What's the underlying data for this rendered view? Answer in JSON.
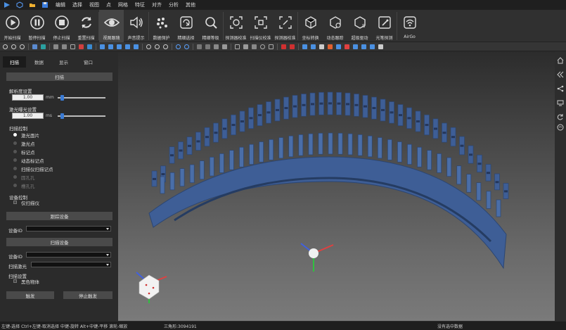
{
  "menubar": {
    "items": [
      "编辑",
      "选择",
      "视图",
      "点",
      "网格",
      "特征",
      "对齐",
      "分析",
      "其他"
    ]
  },
  "ribbon": {
    "buttons": [
      {
        "label": "开始扫描",
        "icon": "play-icon"
      },
      {
        "label": "暂停扫描",
        "icon": "pause-icon"
      },
      {
        "label": "停止扫描",
        "icon": "stop-icon"
      },
      {
        "label": "重置扫描",
        "icon": "reset-icon"
      },
      {
        "label": "视图跟随",
        "icon": "eye-icon"
      },
      {
        "label": "声音提示",
        "icon": "speaker-icon"
      },
      {
        "label": "数据保护",
        "icon": "data-protect-icon"
      },
      {
        "label": "精细选择",
        "icon": "refine-select-icon"
      },
      {
        "label": "精细等级",
        "icon": "refine-level-icon"
      },
      {
        "label": "探测器校准",
        "icon": "detector-calib-icon"
      },
      {
        "label": "扫描仪校准",
        "icon": "scanner-calib-icon"
      },
      {
        "label": "探测器校准",
        "icon": "probe-calib-icon"
      },
      {
        "label": "坐标转换",
        "icon": "coord-transform-icon"
      },
      {
        "label": "动态跟踪",
        "icon": "dynamic-track-icon"
      },
      {
        "label": "超级驱动",
        "icon": "super-drive-icon"
      },
      {
        "label": "光笔探测",
        "icon": "light-pen-icon"
      },
      {
        "label": "AirGo",
        "icon": "wifi-icon"
      }
    ]
  },
  "panel": {
    "tabs": [
      "扫描",
      "数据",
      "显示",
      "窗口"
    ],
    "scan_section": "扫描",
    "resolution_label": "解析度设置",
    "resolution_value": "1.00",
    "resolution_unit": "mm",
    "exposure_label": "激光曝光设置",
    "exposure_value": "1.00",
    "exposure_unit": "ms",
    "scan_control_label": "扫描控制",
    "scan_options": [
      {
        "label": "激光面片",
        "selected": true,
        "enabled": true
      },
      {
        "label": "激光点",
        "selected": false,
        "enabled": true
      },
      {
        "label": "标记点",
        "selected": false,
        "enabled": true
      },
      {
        "label": "动态标记点",
        "selected": false,
        "enabled": true
      },
      {
        "label": "扫描仪扫描记点",
        "selected": false,
        "enabled": true
      },
      {
        "label": "圆孔孔",
        "selected": false,
        "enabled": false
      },
      {
        "label": "槽孔孔",
        "selected": false,
        "enabled": false
      }
    ],
    "device_control_label": "设备控制",
    "scanner_only_label": "仅扫描仪",
    "track_device_section": "跟踪设备",
    "device_id_label": "设备ID",
    "scan_device_section": "扫描设备",
    "device_id_label2": "设备ID",
    "laser_label": "扫描激光",
    "scan_settings_label": "扫描设置",
    "black_object_label": "黑色物体",
    "trigger_button": "触发",
    "stop_trigger_button": "停止触发"
  },
  "status": {
    "hint": "左键-选择 Ctrl+左键-取消选择 中键-旋转 Alt+中键-平移 滚轮-缩放",
    "triangles": "三角形:3094191",
    "selection": "没有选中数据"
  },
  "colors": {
    "accent": "#3a7bd5",
    "model": "#3e5e96",
    "axis_x": "#e04040",
    "axis_y": "#30c040",
    "axis_z": "#4060e0"
  }
}
